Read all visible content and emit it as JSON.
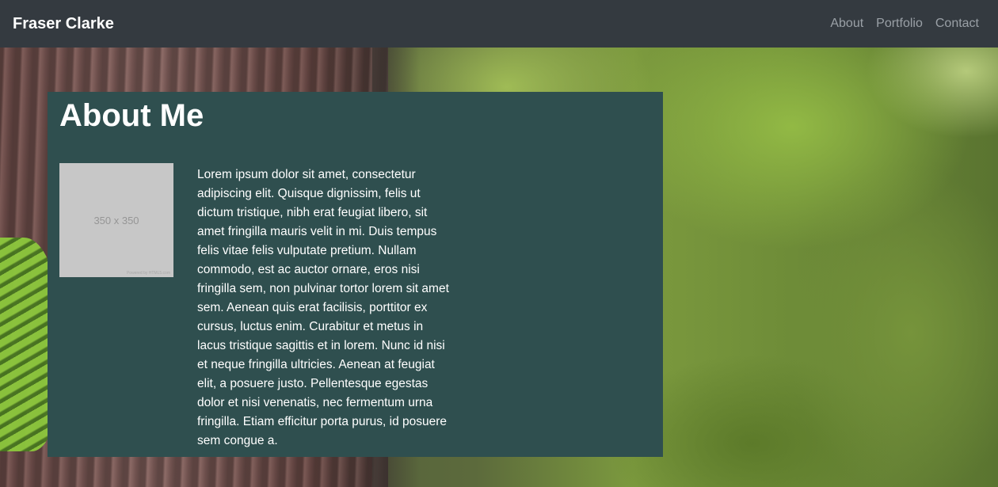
{
  "navbar": {
    "brand": "Fraser Clarke",
    "links": [
      {
        "label": "About"
      },
      {
        "label": "Portfolio"
      },
      {
        "label": "Contact"
      }
    ]
  },
  "about": {
    "title": "About Me",
    "image": {
      "dimensions_text": "350 x 350",
      "powered_text": "Powered by HTML5.com"
    },
    "bio": "Lorem ipsum dolor sit amet, consectetur adipiscing elit. Quisque dignissim, felis ut dictum tristique, nibh erat feugiat libero, sit amet fringilla mauris velit in mi. Duis tempus felis vitae felis vulputate pretium. Nullam commodo, est ac auctor ornare, eros nisi fringilla sem, non pulvinar tortor lorem sit amet sem. Aenean quis erat facilisis, porttitor ex cursus, luctus enim. Curabitur et metus in lacus tristique sagittis et in lorem. Nunc id nisi et neque fringilla ultricies. Aenean at feugiat elit, a posuere justo. Pellentesque egestas dolor et nisi venenatis, nec fermentum urna fringilla. Etiam efficitur porta purus, id posuere sem congue a."
  },
  "colors": {
    "navbar_bg": "#343a40",
    "panel_bg": "#2f4f4f",
    "nav_link": "#9aa0a6"
  }
}
